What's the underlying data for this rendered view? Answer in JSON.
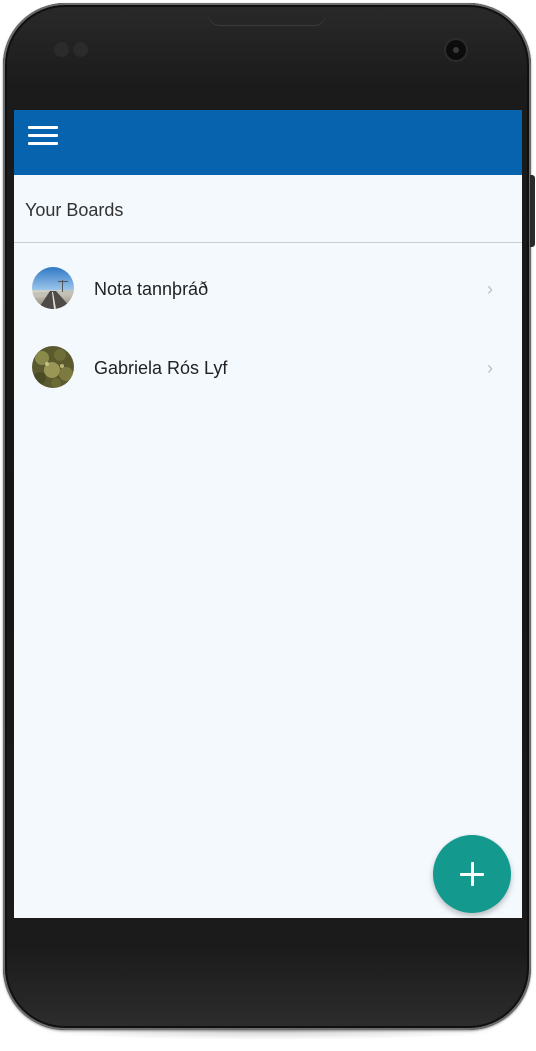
{
  "app_bar": {
    "menu_icon": "hamburger-menu-icon",
    "background_color": "#0763ad"
  },
  "subheader": {
    "title": "Your Boards"
  },
  "boards": [
    {
      "label": "Nota tannþráð",
      "avatar": "highway-landscape-photo",
      "chevron_icon": "chevron-right-icon"
    },
    {
      "label": "Gabriela Rós Lyf",
      "avatar": "olive-green-texture-photo",
      "chevron_icon": "chevron-right-icon"
    }
  ],
  "fab": {
    "icon": "plus-icon",
    "color": "#13998e"
  },
  "colors": {
    "screen_background": "#f3f9fd"
  }
}
